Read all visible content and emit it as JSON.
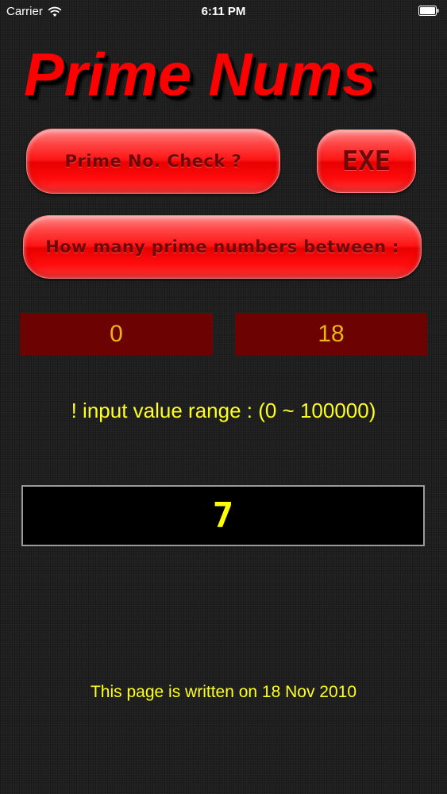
{
  "status_bar": {
    "carrier": "Carrier",
    "time": "6:11 PM",
    "wifi_icon": "wifi-icon",
    "battery_icon": "battery-icon"
  },
  "app": {
    "title": "Prime Nums"
  },
  "buttons": {
    "prime_check_label": "Prime No. Check ?",
    "exe_label": "EXE",
    "between_label": "How many prime numbers between :"
  },
  "inputs": {
    "range_from_value": "0",
    "range_to_value": "18"
  },
  "info": {
    "range_note": "!  input value range : (0 ~ 100000)"
  },
  "result": {
    "value": "7"
  },
  "footer": {
    "note": "This page is written on 18 Nov 2010"
  },
  "colors": {
    "title_red": "#ff0000",
    "button_red": "#ff1414",
    "button_text": "#6e0808",
    "input_bg": "#6d0202",
    "input_text": "#e9b418",
    "info_yellow": "#ffff22",
    "result_yellow": "#ffff00",
    "background": "#1f1f1f"
  }
}
